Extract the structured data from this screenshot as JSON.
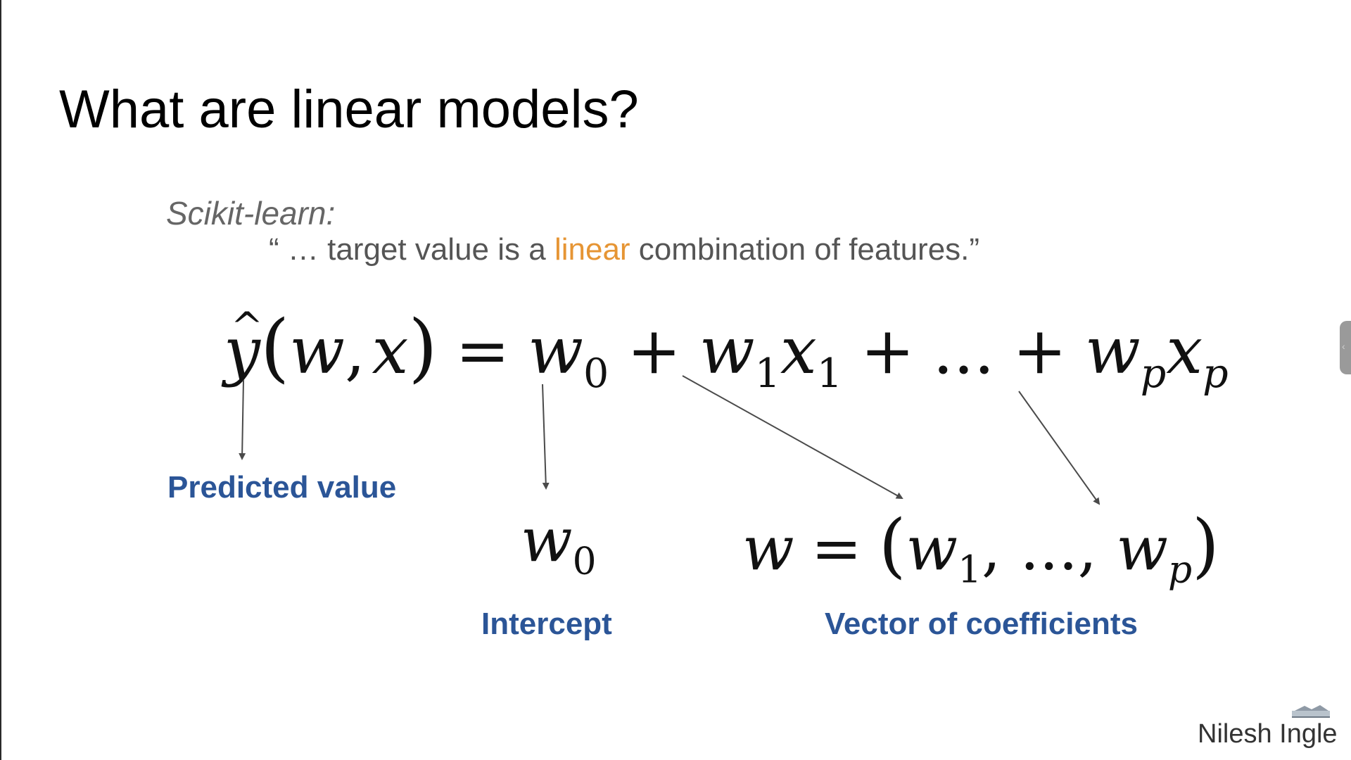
{
  "slide": {
    "title": "What are linear models?",
    "source": "Scikit-learn:",
    "quote_before": "“ … target value is a ",
    "quote_accent": "linear",
    "quote_after": " combination of features.”",
    "accent_color": "#e69534",
    "label_color": "#2b5597"
  },
  "equation": {
    "y": "y",
    "hat": "^",
    "lp": "(",
    "w": "w",
    "comma": ",",
    "x": "x",
    "rp": ")",
    "eq": "=",
    "w0_base": "w",
    "w0_sub": "0",
    "plus1": "+",
    "w1_base": "w",
    "w1_sub": "1",
    "x1_base": "x",
    "x1_sub": "1",
    "plus2": "+",
    "dots": "...",
    "plus3": "+",
    "wp_base": "w",
    "wp_sub": "p",
    "xp_base": "x",
    "xp_sub": "p"
  },
  "intercept_symbol": {
    "base": "w",
    "sub": "0"
  },
  "coef_vector": {
    "lhs": "w",
    "eq": "=",
    "lp": "(",
    "w1_base": "w",
    "w1_sub": "1",
    "sep": ", ..., ",
    "wp_base": "w",
    "wp_sub": "p",
    "rp": ")"
  },
  "labels": {
    "predicted_value": "Predicted value",
    "intercept": "Intercept",
    "vector_of_coefficients": "Vector of coefficients"
  },
  "author": "Nilesh Ingle",
  "icons": {
    "side_panel": "chevron-left-icon",
    "logo": "logo-icon"
  }
}
